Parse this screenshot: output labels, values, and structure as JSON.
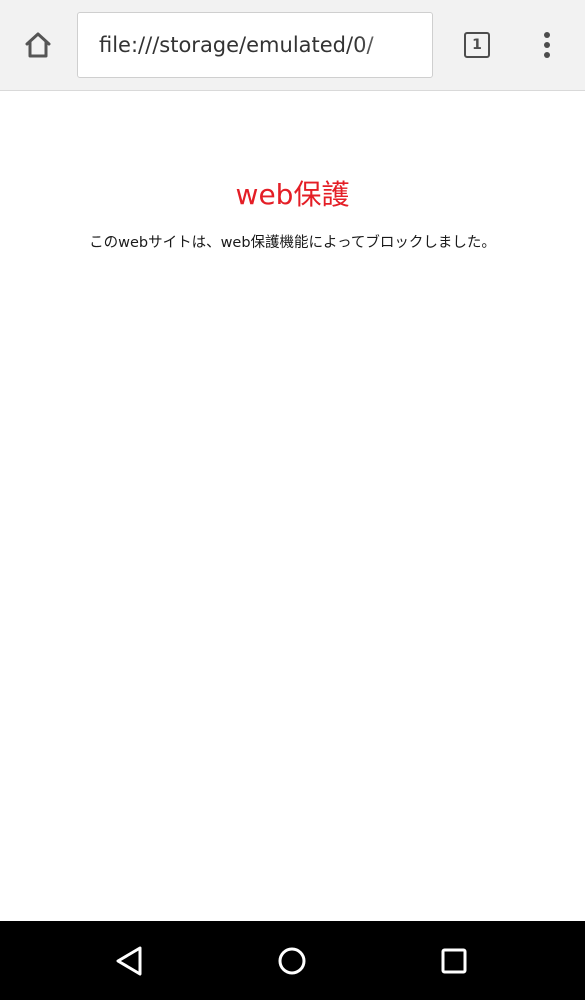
{
  "browser": {
    "url": "file:///storage/emulated/0/",
    "tab_count": "1",
    "icons": {
      "home": "home-icon",
      "tabs": "tabs-icon",
      "menu": "overflow-menu-icon"
    }
  },
  "page": {
    "title": "web保護",
    "message": "このwebサイトは、web保護機能によってブロックしました。",
    "title_color": "#e41e26"
  },
  "system_nav": {
    "icons": {
      "back": "back-icon",
      "home": "home-circle-icon",
      "recents": "recents-icon"
    }
  }
}
